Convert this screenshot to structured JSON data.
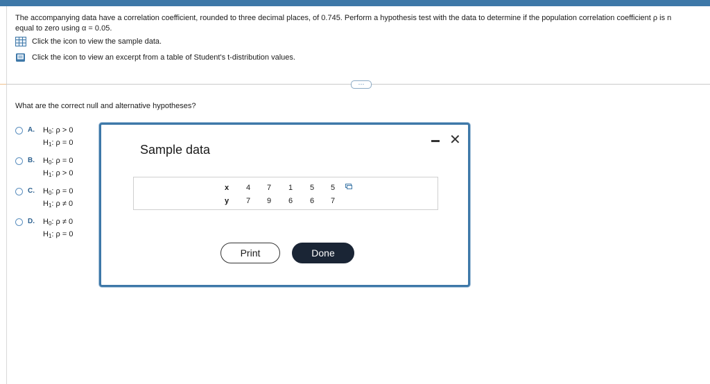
{
  "problem": {
    "line1": "The accompanying data have a correlation coefficient, rounded to three decimal places, of 0.745. Perform a hypothesis test with the data to determine if the population correlation coefficient ρ is n",
    "line2": "equal to zero using α = 0.05."
  },
  "links": {
    "sample_data": "Click the icon to view the sample data.",
    "t_table": "Click the icon to view an excerpt from a table of Student's t-distribution values."
  },
  "more_button": "⋯",
  "question": "What are the correct null and alternative hypotheses?",
  "options": [
    {
      "letter": "A.",
      "h0_rel": "ρ > 0",
      "h1_rel": "ρ = 0"
    },
    {
      "letter": "B.",
      "h0_rel": "ρ = 0",
      "h1_rel": "ρ > 0"
    },
    {
      "letter": "C.",
      "h0_rel": "ρ = 0",
      "h1_rel": "ρ ≠ 0"
    },
    {
      "letter": "D.",
      "h0_rel": "ρ ≠ 0",
      "h1_rel": "ρ = 0"
    }
  ],
  "hyp": {
    "H": "H",
    "sub0": "0",
    "sub1": "1",
    "colon": ":"
  },
  "dialog": {
    "title": "Sample data",
    "close": "✕",
    "table": {
      "x_label": "x",
      "y_label": "y",
      "x": [
        "4",
        "7",
        "1",
        "5",
        "5"
      ],
      "y": [
        "7",
        "9",
        "6",
        "6",
        "7"
      ]
    },
    "print_label": "Print",
    "done_label": "Done"
  },
  "colors": {
    "accent": "#3e78a8",
    "done_bg": "#1a2535"
  },
  "icons": {
    "sample_data": "table-grid-icon",
    "t_table": "book-icon",
    "copy": "copy-icon",
    "minimize": "minimize-icon",
    "close": "close-icon"
  }
}
